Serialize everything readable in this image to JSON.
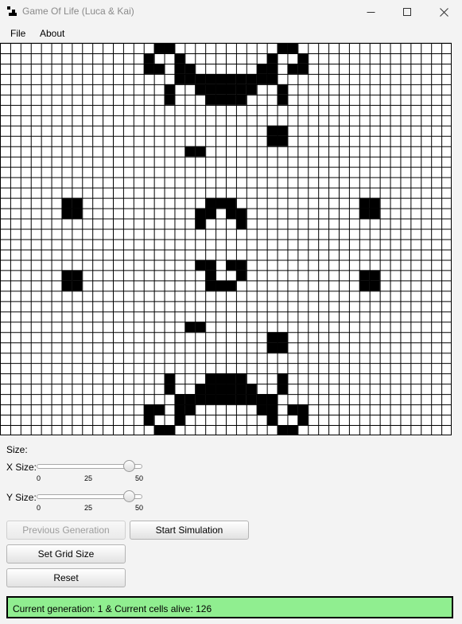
{
  "window": {
    "title": "Game Of Life (Luca & Kai)"
  },
  "menu": {
    "items": [
      "File",
      "About"
    ]
  },
  "grid": {
    "columns": 44,
    "rows": 38,
    "alive_color": "#000000",
    "dead_color": "#ffffff",
    "line_color": "#000000",
    "alive_cells": [
      [
        15,
        0
      ],
      [
        16,
        0
      ],
      [
        27,
        0
      ],
      [
        28,
        0
      ],
      [
        14,
        1
      ],
      [
        17,
        1
      ],
      [
        26,
        1
      ],
      [
        29,
        1
      ],
      [
        14,
        2
      ],
      [
        15,
        2
      ],
      [
        17,
        2
      ],
      [
        18,
        2
      ],
      [
        25,
        2
      ],
      [
        26,
        2
      ],
      [
        28,
        2
      ],
      [
        29,
        2
      ],
      [
        17,
        3
      ],
      [
        18,
        3
      ],
      [
        19,
        3
      ],
      [
        20,
        3
      ],
      [
        21,
        3
      ],
      [
        22,
        3
      ],
      [
        23,
        3
      ],
      [
        24,
        3
      ],
      [
        25,
        3
      ],
      [
        26,
        3
      ],
      [
        16,
        4
      ],
      [
        19,
        4
      ],
      [
        20,
        4
      ],
      [
        21,
        4
      ],
      [
        22,
        4
      ],
      [
        23,
        4
      ],
      [
        24,
        4
      ],
      [
        27,
        4
      ],
      [
        16,
        5
      ],
      [
        20,
        5
      ],
      [
        21,
        5
      ],
      [
        22,
        5
      ],
      [
        23,
        5
      ],
      [
        27,
        5
      ],
      [
        26,
        8
      ],
      [
        27,
        8
      ],
      [
        26,
        9
      ],
      [
        27,
        9
      ],
      [
        18,
        10
      ],
      [
        19,
        10
      ],
      [
        6,
        15
      ],
      [
        7,
        15
      ],
      [
        20,
        15
      ],
      [
        21,
        15
      ],
      [
        22,
        15
      ],
      [
        35,
        15
      ],
      [
        36,
        15
      ],
      [
        6,
        16
      ],
      [
        7,
        16
      ],
      [
        19,
        16
      ],
      [
        20,
        16
      ],
      [
        22,
        16
      ],
      [
        23,
        16
      ],
      [
        35,
        16
      ],
      [
        36,
        16
      ],
      [
        19,
        17
      ],
      [
        23,
        17
      ],
      [
        19,
        21
      ],
      [
        20,
        21
      ],
      [
        22,
        21
      ],
      [
        23,
        21
      ],
      [
        6,
        22
      ],
      [
        7,
        22
      ],
      [
        20,
        22
      ],
      [
        23,
        22
      ],
      [
        35,
        22
      ],
      [
        36,
        22
      ],
      [
        6,
        23
      ],
      [
        7,
        23
      ],
      [
        20,
        23
      ],
      [
        21,
        23
      ],
      [
        22,
        23
      ],
      [
        35,
        23
      ],
      [
        36,
        23
      ],
      [
        18,
        27
      ],
      [
        19,
        27
      ],
      [
        26,
        28
      ],
      [
        27,
        28
      ],
      [
        26,
        29
      ],
      [
        27,
        29
      ],
      [
        16,
        32
      ],
      [
        20,
        32
      ],
      [
        21,
        32
      ],
      [
        22,
        32
      ],
      [
        23,
        32
      ],
      [
        27,
        32
      ],
      [
        16,
        33
      ],
      [
        19,
        33
      ],
      [
        20,
        33
      ],
      [
        21,
        33
      ],
      [
        22,
        33
      ],
      [
        23,
        33
      ],
      [
        24,
        33
      ],
      [
        27,
        33
      ],
      [
        17,
        34
      ],
      [
        18,
        34
      ],
      [
        19,
        34
      ],
      [
        20,
        34
      ],
      [
        21,
        34
      ],
      [
        22,
        34
      ],
      [
        23,
        34
      ],
      [
        24,
        34
      ],
      [
        25,
        34
      ],
      [
        26,
        34
      ],
      [
        14,
        35
      ],
      [
        15,
        35
      ],
      [
        17,
        35
      ],
      [
        18,
        35
      ],
      [
        25,
        35
      ],
      [
        26,
        35
      ],
      [
        28,
        35
      ],
      [
        29,
        35
      ],
      [
        14,
        36
      ],
      [
        17,
        36
      ],
      [
        26,
        36
      ],
      [
        29,
        36
      ],
      [
        15,
        37
      ],
      [
        16,
        37
      ],
      [
        27,
        37
      ],
      [
        28,
        37
      ]
    ]
  },
  "controls": {
    "size_label": "Size:",
    "x_slider": {
      "label": "X Size:",
      "min": 0,
      "max": 50,
      "value": 44,
      "ticks": [
        "0",
        "25",
        "50"
      ]
    },
    "y_slider": {
      "label": "Y Size:",
      "min": 0,
      "max": 50,
      "value": 44,
      "ticks": [
        "0",
        "25",
        "50"
      ]
    },
    "buttons": {
      "previous_generation": "Previous Generation",
      "start_simulation": "Start Simulation",
      "set_grid_size": "Set Grid Size",
      "reset": "Reset"
    }
  },
  "status": {
    "text": "Current generation: 1 & Current cells alive: 126",
    "background": "#90ee90"
  }
}
